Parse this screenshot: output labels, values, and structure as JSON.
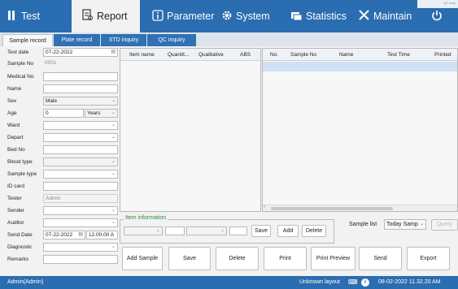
{
  "nav": [
    {
      "label": "Test",
      "icon": "test-tubes-icon"
    },
    {
      "label": "Report",
      "icon": "report-icon"
    },
    {
      "label": "Parameter",
      "icon": "info-icon"
    },
    {
      "label": "System",
      "icon": "gear-icon"
    },
    {
      "label": "Statistics",
      "icon": "statistics-icon"
    },
    {
      "label": "Maintain",
      "icon": "tools-icon"
    },
    {
      "label": "",
      "icon": "power-icon"
    }
  ],
  "corner_text": "QC time",
  "subtabs": [
    "Sample record",
    "Plate record",
    "STD inquiry",
    "QC inquiry"
  ],
  "form": {
    "test_date": {
      "label": "Test date",
      "value": "07-22-2022"
    },
    "sample_no": {
      "label": "Sample No",
      "value": "0001"
    },
    "medical_no": {
      "label": "Medical No",
      "value": ""
    },
    "name": {
      "label": "Name",
      "value": ""
    },
    "sex": {
      "label": "Sex",
      "value": "Male"
    },
    "age": {
      "label": "Age",
      "value": "0",
      "unit": "Years"
    },
    "ward": {
      "label": "Ward",
      "value": ""
    },
    "depart": {
      "label": "Depart",
      "value": ""
    },
    "bed_no": {
      "label": "Bed No",
      "value": ""
    },
    "blood_type": {
      "label": "Blood type",
      "value": ""
    },
    "sample_type": {
      "label": "Sample type",
      "value": ""
    },
    "id_card": {
      "label": "ID card",
      "value": ""
    },
    "tester": {
      "label": "Tester",
      "value": "Admin"
    },
    "sender": {
      "label": "Sender",
      "value": ""
    },
    "auditor": {
      "label": "Auditor",
      "value": ""
    },
    "send_date": {
      "label": "Send Date",
      "value": "07-22-2022",
      "time": "12.00.00 A"
    },
    "diagnostic": {
      "label": "Diagnostic",
      "value": ""
    },
    "remarks": {
      "label": "Remarks",
      "value": ""
    }
  },
  "item_table": {
    "headers": [
      "Item name",
      "Quantit...",
      "Qualitative",
      "ABS"
    ]
  },
  "sample_table": {
    "headers": [
      "No.",
      "Sample No",
      "Name",
      "Test Time",
      "Printed"
    ]
  },
  "item_info": {
    "legend": "Item information",
    "save_label": "Save",
    "add_label": "Add",
    "delete_label": "Delete"
  },
  "sample_list": {
    "label": "Sample list",
    "value": "Today Samp",
    "query_label": "Query"
  },
  "actions": [
    "Add Sample",
    "Save",
    "Delete",
    "Print",
    "Print Preview",
    "Send",
    "Export"
  ],
  "status": {
    "user": "Admin(Admin)",
    "layout": "Unknown layout",
    "datetime": "08-02-2022 11.32.20 AM"
  },
  "colors": {
    "accent": "#2a6db0",
    "legend_green": "#2e8b3a",
    "selected_row": "#cfe1f4"
  }
}
